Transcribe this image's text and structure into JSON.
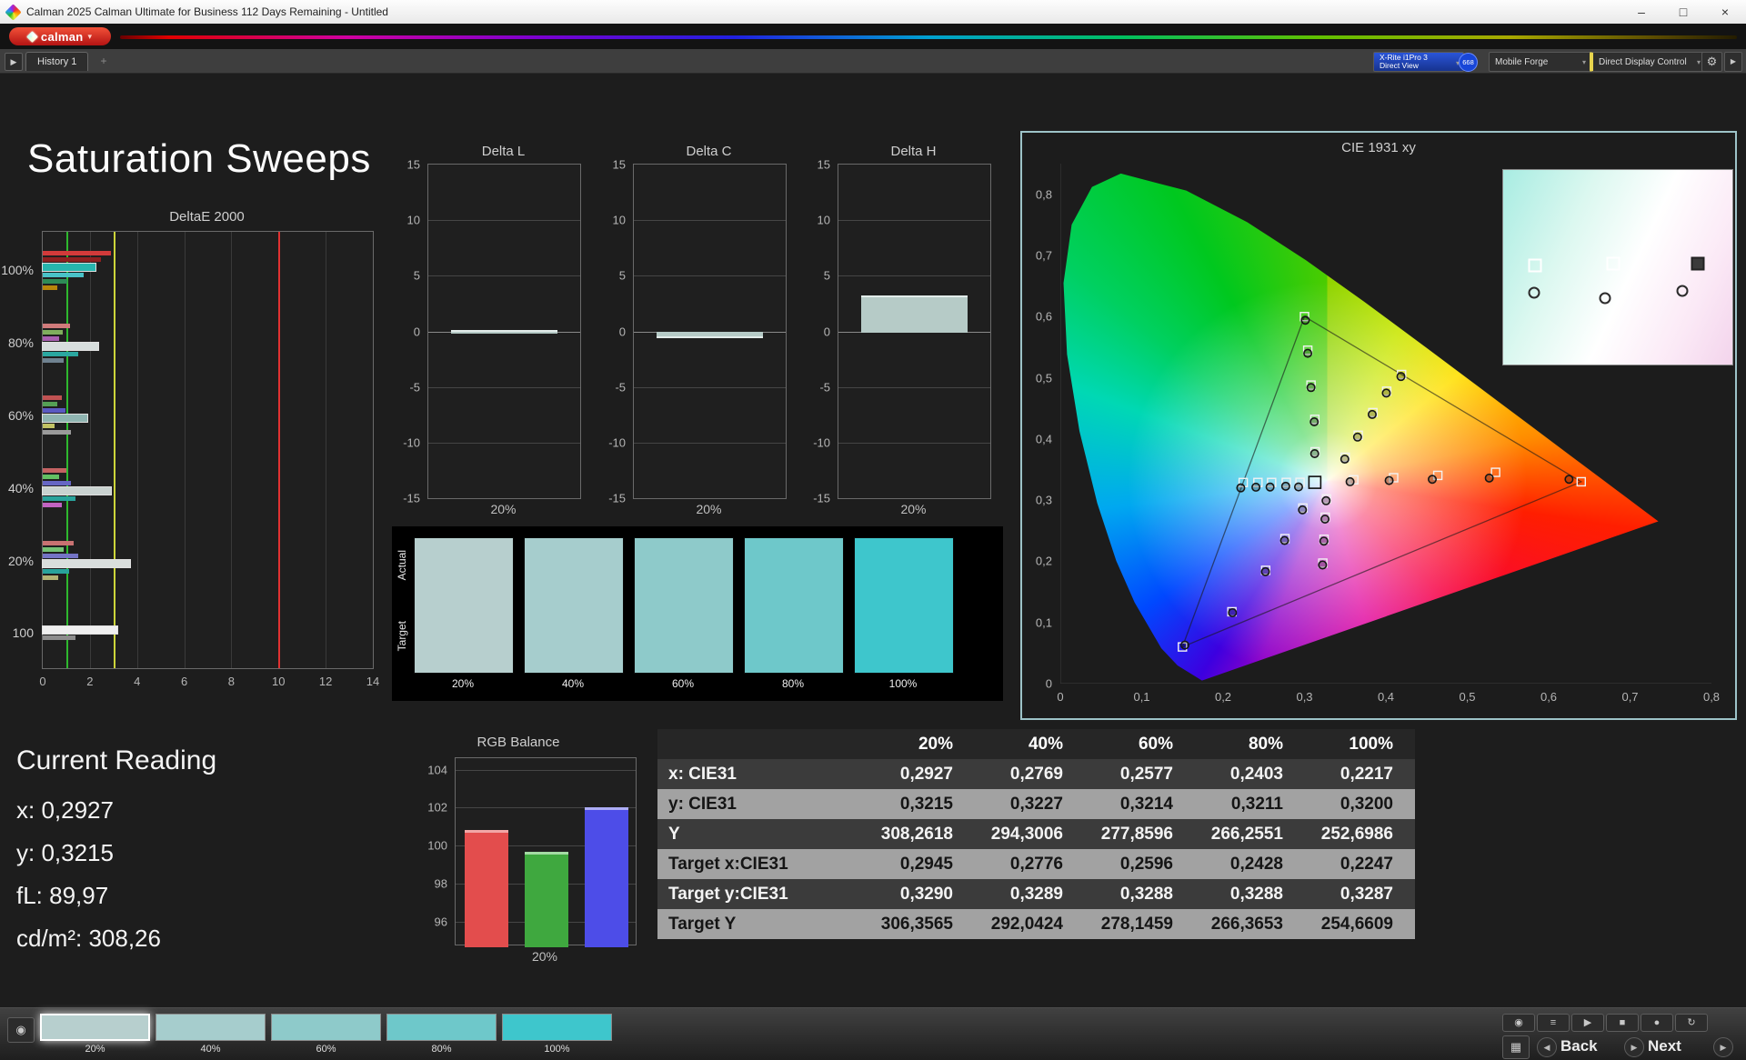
{
  "titlebar": {
    "title": "Calman 2025 Calman Ultimate for Business 112 Days Remaining  - Untitled"
  },
  "logobar": {
    "brand": "calman"
  },
  "toolbar": {
    "history_tab": "History 1",
    "meter_line1": "X-Rite i1Pro 3",
    "meter_line2": "Direct View",
    "meter_badge": "668",
    "source": "Mobile Forge",
    "control": "Direct Display Control"
  },
  "page": {
    "title": "Saturation Sweeps"
  },
  "icons": {
    "minimize": "–",
    "maximize": "□",
    "close": "×",
    "caret": "▾",
    "expand": "▶",
    "add": "+",
    "gear": "⚙",
    "panel": "▶",
    "eye": "◉",
    "layout": "▦",
    "backaudio": "◀",
    "nextaudio": "▶"
  },
  "chart_data": {
    "deltae": {
      "type": "bar-h",
      "title": "DeltaE 2000",
      "x_ticks": [
        0,
        2,
        4,
        6,
        8,
        10,
        12,
        14
      ],
      "x_max": 14,
      "ref_lines": [
        {
          "value": 1,
          "color": "#2eb82e"
        },
        {
          "value": 3,
          "color": "#cdd53a"
        },
        {
          "value": 10,
          "color": "#e03131"
        }
      ],
      "groups": [
        {
          "label": "100%",
          "bars": [
            {
              "color": "#d23a3a",
              "value": 2.9
            },
            {
              "color": "#8f1f1f",
              "value": 2.45
            },
            {
              "color": "#27b5ad",
              "value": 2.25,
              "hl": true
            },
            {
              "color": "#49c2c8",
              "value": 1.75
            },
            {
              "color": "#2e8b57",
              "value": 1.05
            },
            {
              "color": "#b8860b",
              "value": 0.6
            }
          ]
        },
        {
          "label": "80%",
          "bars": [
            {
              "color": "#d07b7b",
              "value": 1.15
            },
            {
              "color": "#7fae5d",
              "value": 0.85
            },
            {
              "color": "#a85fb0",
              "value": 0.7
            },
            {
              "color": "#d7dedd",
              "value": 2.35,
              "hl": true
            },
            {
              "color": "#2aa7a0",
              "value": 1.5
            },
            {
              "color": "#6f8290",
              "value": 0.9
            }
          ]
        },
        {
          "label": "60%",
          "bars": [
            {
              "color": "#c05252",
              "value": 0.8
            },
            {
              "color": "#55a055",
              "value": 0.6
            },
            {
              "color": "#5a5ac2",
              "value": 0.95
            },
            {
              "color": "#8fb5b1",
              "value": 1.9,
              "hl": true
            },
            {
              "color": "#c2c264",
              "value": 0.5
            },
            {
              "color": "#9a9a9a",
              "value": 1.2
            }
          ]
        },
        {
          "label": "40%",
          "bars": [
            {
              "color": "#c46262",
              "value": 1.0
            },
            {
              "color": "#63c063",
              "value": 0.7
            },
            {
              "color": "#6666c4",
              "value": 1.2
            },
            {
              "color": "#c9d2d0",
              "value": 2.9,
              "hl": true
            },
            {
              "color": "#29a39c",
              "value": 1.4
            },
            {
              "color": "#c263c2",
              "value": 0.8
            }
          ]
        },
        {
          "label": "20%",
          "bars": [
            {
              "color": "#c87272",
              "value": 1.3
            },
            {
              "color": "#74c274",
              "value": 0.9
            },
            {
              "color": "#7474c6",
              "value": 1.5
            },
            {
              "color": "#d9dedd",
              "value": 3.7,
              "hl": true
            },
            {
              "color": "#29a39c",
              "value": 1.1
            },
            {
              "color": "#b3b374",
              "value": 0.65
            }
          ]
        },
        {
          "label": "100",
          "bars": [
            {
              "color": "#efefef",
              "value": 3.15,
              "hl": true
            },
            {
              "color": "#8d8d8d",
              "value": 1.4
            }
          ]
        }
      ]
    },
    "delta_shared": {
      "y_ticks": [
        15,
        10,
        5,
        0,
        -5,
        -10,
        -15
      ],
      "y_min": -15,
      "y_max": 15,
      "x_label": "20%",
      "bar_color": "#b6cbc7",
      "edge_color": "#e2ecea"
    },
    "delta_small": [
      {
        "type": "bar",
        "title": "Delta L",
        "value": 0.15
      },
      {
        "type": "bar",
        "title": "Delta C",
        "value": -0.45
      },
      {
        "type": "bar",
        "title": "Delta H",
        "value": 3.2
      }
    ],
    "rgb": {
      "type": "bar",
      "title": "RGB Balance",
      "x_label": "20%",
      "y_ticks": [
        104,
        102,
        100,
        98,
        96
      ],
      "y_min": 94.8,
      "y_max": 104.6,
      "bars": [
        {
          "name": "red",
          "value": 100.8,
          "color": "#e34d4d",
          "edge": "#f2a6a6"
        },
        {
          "name": "green",
          "value": 99.7,
          "color": "#3fa83f",
          "edge": "#a4dba4"
        },
        {
          "name": "blue",
          "value": 102.0,
          "color": "#4d4de8",
          "edge": "#adadf6"
        }
      ]
    },
    "cie": {
      "type": "scatter",
      "title": "CIE 1931 xy",
      "x_ticks": [
        "0",
        "0,1",
        "0,2",
        "0,3",
        "0,4",
        "0,5",
        "0,6",
        "0,7",
        "0,8"
      ],
      "y_ticks": [
        "0",
        "0,1",
        "0,2",
        "0,3",
        "0,4",
        "0,5",
        "0,6",
        "0,7",
        "0,8"
      ],
      "x_max": 0.8,
      "y_max": 0.85,
      "locus": [
        [
          0.1741,
          0.005
        ],
        [
          0.144,
          0.0297
        ],
        [
          0.1241,
          0.0578
        ],
        [
          0.0913,
          0.1327
        ],
        [
          0.0687,
          0.2007
        ],
        [
          0.0454,
          0.295
        ],
        [
          0.0235,
          0.4127
        ],
        [
          0.0082,
          0.5384
        ],
        [
          0.0039,
          0.6548
        ],
        [
          0.0139,
          0.7502
        ],
        [
          0.0389,
          0.812
        ],
        [
          0.0743,
          0.8338
        ],
        [
          0.1547,
          0.8059
        ],
        [
          0.2296,
          0.7543
        ],
        [
          0.3016,
          0.6923
        ],
        [
          0.3731,
          0.6245
        ],
        [
          0.4441,
          0.5547
        ],
        [
          0.5125,
          0.4866
        ],
        [
          0.5752,
          0.4242
        ],
        [
          0.627,
          0.3725
        ],
        [
          0.6658,
          0.334
        ],
        [
          0.6915,
          0.3083
        ],
        [
          0.714,
          0.2859
        ],
        [
          0.7347,
          0.2653
        ]
      ],
      "triangle": [
        [
          0.64,
          0.33
        ],
        [
          0.3,
          0.6
        ],
        [
          0.15,
          0.06
        ]
      ],
      "white_point": [
        0.3127,
        0.329
      ],
      "targets": [
        [
          0.2945,
          0.329
        ],
        [
          0.2776,
          0.3289
        ],
        [
          0.2596,
          0.3288
        ],
        [
          0.2428,
          0.3288
        ],
        [
          0.2247,
          0.3287
        ],
        [
          0.3605,
          0.3332
        ],
        [
          0.4095,
          0.3366
        ],
        [
          0.4638,
          0.3404
        ],
        [
          0.5348,
          0.3454
        ],
        [
          0.64,
          0.33
        ],
        [
          0.313,
          0.379
        ],
        [
          0.3127,
          0.432
        ],
        [
          0.308,
          0.488
        ],
        [
          0.304,
          0.545
        ],
        [
          0.3,
          0.6
        ],
        [
          0.298,
          0.287
        ],
        [
          0.276,
          0.237
        ],
        [
          0.2523,
          0.1852
        ],
        [
          0.2108,
          0.1175
        ],
        [
          0.15,
          0.06
        ],
        [
          0.327,
          0.302
        ],
        [
          0.3255,
          0.272
        ],
        [
          0.324,
          0.236
        ],
        [
          0.3225,
          0.197
        ],
        [
          0.35,
          0.37
        ],
        [
          0.366,
          0.406
        ],
        [
          0.384,
          0.443
        ],
        [
          0.401,
          0.478
        ],
        [
          0.4193,
          0.5053
        ]
      ],
      "measured": [
        [
          0.2927,
          0.3215
        ],
        [
          0.2769,
          0.3227
        ],
        [
          0.2577,
          0.3214
        ],
        [
          0.2403,
          0.3211
        ],
        [
          0.2217,
          0.32
        ],
        [
          0.356,
          0.33
        ],
        [
          0.404,
          0.332
        ],
        [
          0.457,
          0.334
        ],
        [
          0.527,
          0.336
        ],
        [
          0.625,
          0.334
        ],
        [
          0.3125,
          0.376
        ],
        [
          0.312,
          0.428
        ],
        [
          0.308,
          0.484
        ],
        [
          0.304,
          0.54
        ],
        [
          0.301,
          0.594
        ],
        [
          0.2975,
          0.284
        ],
        [
          0.2755,
          0.234
        ],
        [
          0.252,
          0.183
        ],
        [
          0.2115,
          0.116
        ],
        [
          0.153,
          0.063
        ],
        [
          0.3265,
          0.299
        ],
        [
          0.3252,
          0.269
        ],
        [
          0.3238,
          0.233
        ],
        [
          0.3222,
          0.194
        ],
        [
          0.3495,
          0.367
        ],
        [
          0.3652,
          0.403
        ],
        [
          0.3832,
          0.44
        ],
        [
          0.4005,
          0.475
        ],
        [
          0.4185,
          0.502
        ]
      ],
      "inset": {
        "squares": [
          {
            "x": 0.14,
            "y": 0.49,
            "dark": false
          },
          {
            "x": 0.48,
            "y": 0.48,
            "dark": false
          },
          {
            "x": 0.85,
            "y": 0.48,
            "dark": true
          }
        ],
        "circles": [
          [
            0.135,
            0.63
          ],
          [
            0.445,
            0.66
          ],
          [
            0.78,
            0.62
          ]
        ]
      }
    }
  },
  "swatches": {
    "row_labels": [
      "Actual",
      "Target"
    ],
    "items": [
      {
        "label": "20%",
        "color": "#b7cfce"
      },
      {
        "label": "40%",
        "color": "#a6cdcd"
      },
      {
        "label": "60%",
        "color": "#8ecaca"
      },
      {
        "label": "80%",
        "color": "#6ec8ca"
      },
      {
        "label": "100%",
        "color": "#3ec6cc"
      }
    ]
  },
  "current_reading": {
    "title": "Current Reading",
    "lines": [
      "x: 0,2927",
      "y: 0,3215",
      "fL: 89,97",
      "cd/m²: 308,26"
    ]
  },
  "table": {
    "columns": [
      "20%",
      "40%",
      "60%",
      "80%",
      "100%"
    ],
    "rows": [
      {
        "label": "x: CIE31",
        "values": [
          "0,2927",
          "0,2769",
          "0,2577",
          "0,2403",
          "0,2217"
        ]
      },
      {
        "label": "y: CIE31",
        "values": [
          "0,3215",
          "0,3227",
          "0,3214",
          "0,3211",
          "0,3200"
        ]
      },
      {
        "label": "Y",
        "values": [
          "308,2618",
          "294,3006",
          "277,8596",
          "266,2551",
          "252,6986"
        ]
      },
      {
        "label": "Target x:CIE31",
        "values": [
          "0,2945",
          "0,2776",
          "0,2596",
          "0,2428",
          "0,2247"
        ]
      },
      {
        "label": "Target y:CIE31",
        "values": [
          "0,3290",
          "0,3289",
          "0,3288",
          "0,3288",
          "0,3287"
        ]
      },
      {
        "label": "Target Y",
        "values": [
          "306,3565",
          "292,0424",
          "278,1459",
          "266,3653",
          "254,6609"
        ]
      }
    ]
  },
  "bottombar": {
    "selected_index": 0,
    "back_label": "Back",
    "next_label": "Next",
    "icons_top": [
      {
        "name": "eye",
        "glyph": "◉"
      },
      {
        "name": "playlist",
        "glyph": "≡"
      },
      {
        "name": "play",
        "glyph": "▶"
      },
      {
        "name": "stop",
        "glyph": "■"
      },
      {
        "name": "record",
        "glyph": "●"
      },
      {
        "name": "loop",
        "glyph": "↻"
      }
    ]
  }
}
